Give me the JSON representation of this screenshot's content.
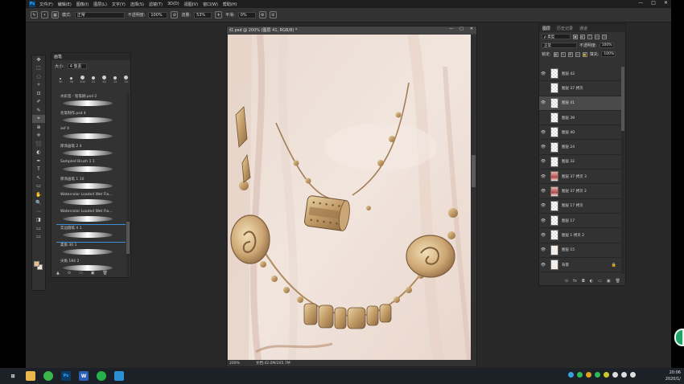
{
  "app": {
    "logo": "Ps",
    "menus": [
      "文件(F)",
      "编辑(E)",
      "图像(I)",
      "图层(L)",
      "文字(Y)",
      "选择(S)",
      "滤镜(T)",
      "3D(D)",
      "视图(V)",
      "窗口(W)",
      "帮助(H)"
    ],
    "window_controls": [
      "—",
      "□",
      "✕"
    ]
  },
  "options_bar": {
    "mode_label": "模式:",
    "mode_value": "正常",
    "opacity_label": "不透明度:",
    "opacity_value": "100%",
    "flow_label": "流量:",
    "flow_value": "53%",
    "smooth_label": "平滑:",
    "smooth_value": "0%"
  },
  "tools": [
    "✥",
    "⬚",
    "◌",
    "✧",
    "⊡",
    "✐",
    "✎",
    "⌖",
    "⊕",
    "✢",
    "⬛",
    "◐",
    "✒",
    "T",
    "↖",
    "▭",
    "✋",
    "🔍",
    "⋯",
    "◨",
    "▭",
    "▭"
  ],
  "brush_panel": {
    "title": "画笔",
    "size_label": "大小:",
    "size_value": "4 像素",
    "tip_sizes": [
      "30",
      "30",
      "100",
      "25",
      "50",
      "25",
      "50"
    ],
    "brushes": [
      {
        "name": "水彩签 - 铅笔刷.psd 2"
      },
      {
        "name": "毛笔制作.psd 4"
      },
      {
        "name": "asf 4"
      },
      {
        "name": "厚涂画笔 2 4"
      },
      {
        "name": "Sampled Brush 1 1"
      },
      {
        "name": "厚涂画笔 1 10"
      },
      {
        "name": "Watercolor Loaded Wet Fla..."
      },
      {
        "name": "Watercolor Loaded Wet Fla..."
      },
      {
        "name": "实边圆笔 4 1"
      },
      {
        "name": "柔角 30 1"
      },
      {
        "name": "尖角 184 2"
      }
    ]
  },
  "document": {
    "tab_title": "红.psd @ 200% (图层 41, RGB/8) *",
    "zoom": "200%",
    "doc_info": "文档:42.0M/205.7M"
  },
  "layers_panel": {
    "tabs": [
      "图层",
      "历史记录",
      "通道"
    ],
    "filter_label": "ρ 类型",
    "blend_mode": "正常",
    "opacity_label": "不透明度:",
    "opacity_value": "100%",
    "lock_label": "锁定:",
    "fill_label": "填充:",
    "fill_value": "100%",
    "layers": [
      {
        "name": "图层 42",
        "visible": "👁"
      },
      {
        "name": "图层 37 拷贝",
        "visible": ""
      },
      {
        "name": "图层 41",
        "visible": "👁"
      },
      {
        "name": "图层 39",
        "visible": ""
      },
      {
        "name": "图层 40",
        "visible": "👁"
      },
      {
        "name": "图层 24",
        "visible": "👁"
      },
      {
        "name": "图层 32",
        "visible": "👁"
      },
      {
        "name": "图层 37 拷贝 3",
        "visible": "👁"
      },
      {
        "name": "图层 37 拷贝 2",
        "visible": "👁"
      },
      {
        "name": "图层 17 拷贝",
        "visible": "👁"
      },
      {
        "name": "图层 17",
        "visible": "👁"
      },
      {
        "name": "图层 1 拷贝 2",
        "visible": "👁"
      },
      {
        "name": "图层 15",
        "visible": "👁"
      },
      {
        "name": "背景",
        "visible": "👁"
      }
    ],
    "footer_icons": [
      "⊙",
      "fx",
      "◘",
      "◐",
      "▭",
      "▣",
      "🗑"
    ]
  },
  "taskbar": {
    "time": "20:06",
    "date": "2020/1/"
  }
}
